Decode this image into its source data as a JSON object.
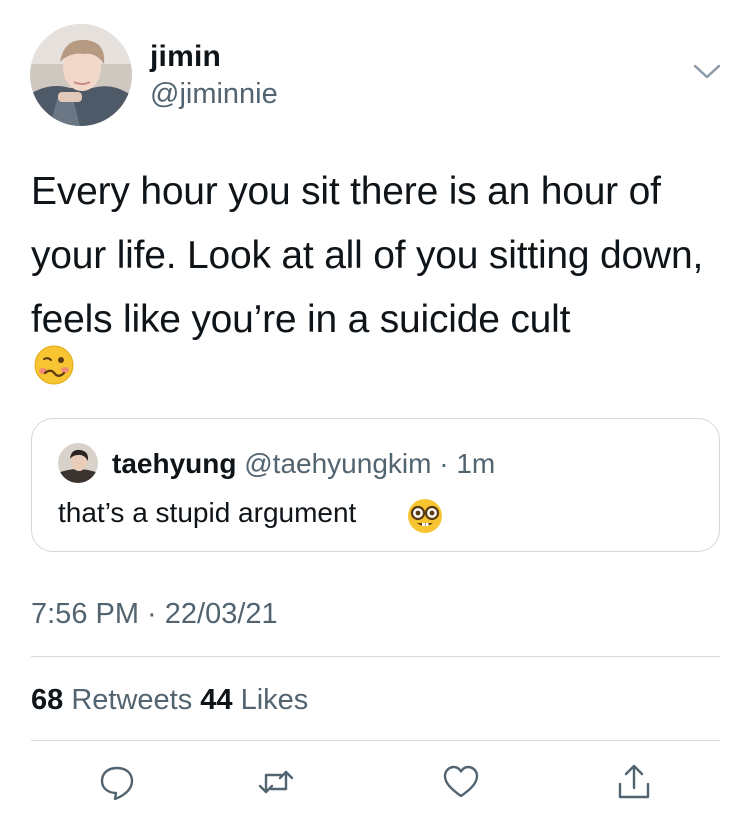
{
  "author": {
    "display_name": "jimin",
    "handle": "@jiminnie"
  },
  "tweet": {
    "text": "Every hour you sit there is an hour of your life. Look at all of you sitting down, feels like you’re in a suicide cult",
    "trailing_emoji": "woozy-face"
  },
  "quoted_tweet": {
    "display_name": "taehyung",
    "handle": "@taehyungkim",
    "separator": "·",
    "time": "1m",
    "text": "that’s a stupid argument",
    "trailing_emoji": "nerd-face"
  },
  "meta": {
    "timestamp": "7:56 PM · 22/03/21"
  },
  "stats": {
    "retweets_count": "68",
    "retweets_label": "Retweets",
    "likes_count": "44",
    "likes_label": "Likes"
  },
  "actions": [
    "reply-icon",
    "retweet-icon",
    "like-icon",
    "share-icon"
  ],
  "colors": {
    "text_primary": "#0f1419",
    "text_secondary": "#536471",
    "border": "#cfd9de"
  }
}
